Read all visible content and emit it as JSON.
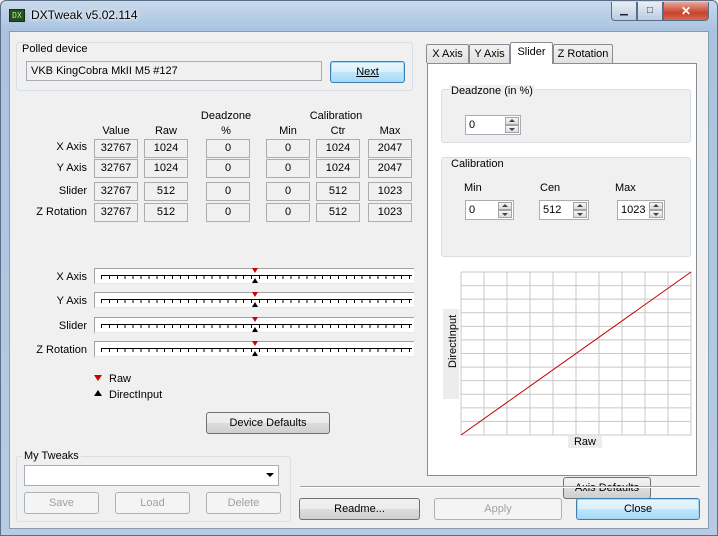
{
  "window": {
    "title": "DXTweak v5.02.114",
    "min_glyph": "▁",
    "max_glyph": "□",
    "close_glyph": "✕"
  },
  "polled": {
    "group_title": "Polled device",
    "device_name": "VKB KingCobra MkII M5 #127",
    "next_label": "Next"
  },
  "table": {
    "headers": {
      "value": "Value",
      "raw": "Raw",
      "deadzone_top": "Deadzone",
      "deadzone": "%",
      "calibration": "Calibration",
      "min": "Min",
      "ctr": "Ctr",
      "max": "Max"
    },
    "rows": [
      {
        "label": "X Axis",
        "value": "32767",
        "raw": "1024",
        "deadzone": "0",
        "min": "0",
        "ctr": "1024",
        "max": "2047"
      },
      {
        "label": "Y Axis",
        "value": "32767",
        "raw": "1024",
        "deadzone": "0",
        "min": "0",
        "ctr": "1024",
        "max": "2047"
      },
      {
        "label": "Slider",
        "value": "32767",
        "raw": "512",
        "deadzone": "0",
        "min": "0",
        "ctr": "512",
        "max": "1023"
      },
      {
        "label": "Z Rotation",
        "value": "32767",
        "raw": "512",
        "deadzone": "0",
        "min": "0",
        "ctr": "512",
        "max": "1023"
      }
    ]
  },
  "bars": {
    "labels": [
      "X Axis",
      "Y Axis",
      "Slider",
      "Z Rotation"
    ],
    "raw_fraction": [
      0.5,
      0.5,
      0.5,
      0.5
    ],
    "di_fraction": [
      0.5,
      0.5,
      0.5,
      0.5
    ]
  },
  "legend": {
    "raw": "Raw",
    "directinput": "DirectInput",
    "raw_color": "#d00000",
    "di_color": "#000000"
  },
  "device_defaults_label": "Device Defaults",
  "tweaks": {
    "group_title": "My Tweaks",
    "selected": "",
    "save_label": "Save",
    "load_label": "Load",
    "delete_label": "Delete"
  },
  "tabs": [
    {
      "label": "X Axis",
      "active": false
    },
    {
      "label": "Y Axis",
      "active": false
    },
    {
      "label": "Slider",
      "active": true
    },
    {
      "label": "Z Rotation",
      "active": false
    }
  ],
  "panel": {
    "deadzone_title": "Deadzone (in %)",
    "deadzone_value": "0",
    "calibration_title": "Calibration",
    "min_label": "Min",
    "cen_label": "Cen",
    "max_label": "Max",
    "min_value": "0",
    "cen_value": "512",
    "max_value": "1023",
    "chart_ylabel": "DirectInput",
    "chart_xlabel": "Raw",
    "line_color": "#c00000",
    "axis_defaults_label": "Axis Defaults"
  },
  "footer": {
    "readme_label": "Readme...",
    "apply_label": "Apply",
    "close_label": "Close"
  },
  "chart_data": {
    "type": "line",
    "xlabel": "Raw",
    "ylabel": "DirectInput",
    "grid": true,
    "series": [
      {
        "x": [
          0,
          1
        ],
        "y": [
          0,
          1
        ]
      }
    ]
  }
}
